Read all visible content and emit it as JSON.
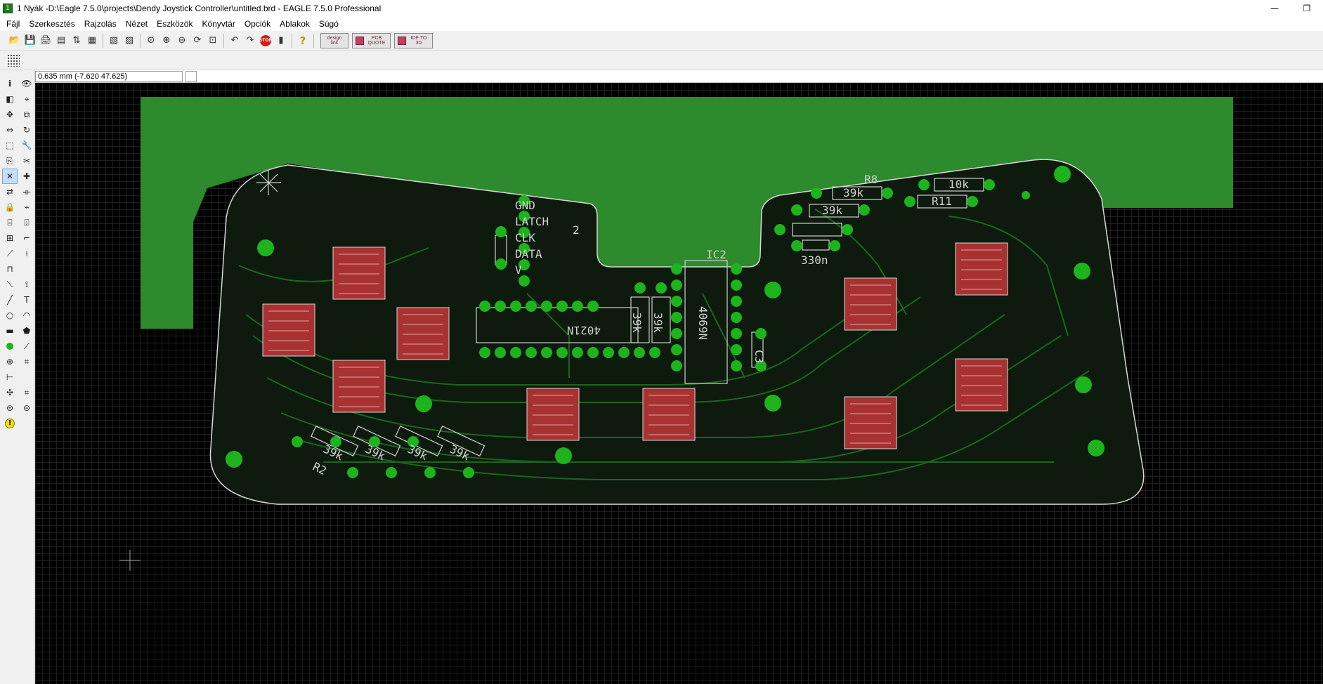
{
  "window": {
    "app_icon_text": "1",
    "title": "1 Nyák -D:\\Eagle 7.5.0\\projects\\Dendy Joystick Controller\\untitled.brd - EAGLE 7.5.0 Professional",
    "minimize": "—",
    "restore": "❐"
  },
  "menu": [
    "Fájl",
    "Szerkesztés",
    "Rajzolás",
    "Nézet",
    "Eszközök",
    "Könyvtár",
    "Opciók",
    "Ablakok",
    "Súgó"
  ],
  "toolbar": {
    "stop": "STOP",
    "design_link": "design link",
    "pcb_quote": "PCB QUOTE",
    "idf_to_3d": "IDF TO 3D",
    "help": "?"
  },
  "status": {
    "coordinate": "0.635 mm (-7.620 47.625)",
    "command": ""
  },
  "board": {
    "labels": {
      "gnd": "GND",
      "latch": "LATCH",
      "clk": "CLK",
      "data": "DATA",
      "v": "V",
      "num2": "2",
      "ic2": "IC2",
      "ic2_value": "4069N",
      "ic1_value": "4021N",
      "c3": "C3",
      "r8": "R8",
      "r8_value": "39k",
      "r9_value": "39k",
      "r_top_right": "10k",
      "r11": "R11",
      "c_value": "330n",
      "r_a": "39k",
      "r_b": "39k",
      "r_bottom_1": "39k",
      "r_bottom_2": "39k",
      "r_bottom_3": "39k",
      "r_bottom_4": "39k",
      "r2": "R2"
    }
  },
  "colors": {
    "canvas": "#000000",
    "polygon": "#2d8a2d",
    "pad": "#1db31d",
    "copper_pad": "#a83232",
    "silkscreen": "#cfcfcf"
  }
}
